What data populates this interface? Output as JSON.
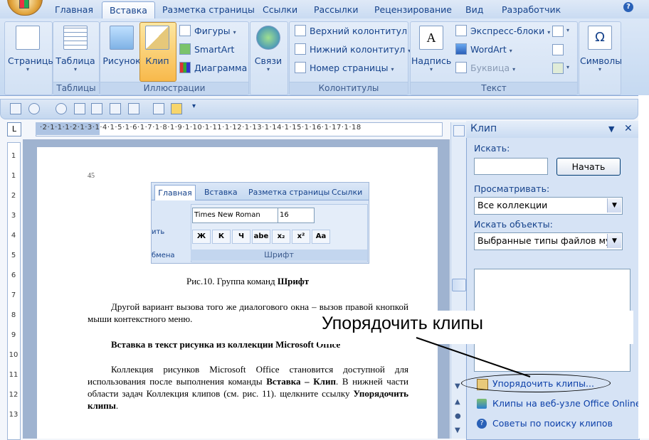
{
  "tabs": [
    "Главная",
    "Вставка",
    "Разметка страницы",
    "Ссылки",
    "Рассылки",
    "Рецензирование",
    "Вид",
    "Разработчик"
  ],
  "active_tab": "Вставка",
  "groups": {
    "pages": {
      "button": "Страницы"
    },
    "tables": {
      "button": "Таблица",
      "label": "Таблицы"
    },
    "illustrations": {
      "label": "Иллюстрации",
      "picture": "Рисунок",
      "clip": "Клип",
      "shapes": "Фигуры",
      "smartart": "SmartArt",
      "chart": "Диаграмма"
    },
    "links": {
      "button": "Связи"
    },
    "header_footer": {
      "label": "Колонтитулы",
      "header": "Верхний колонтитул",
      "footer": "Нижний колонтитул",
      "page_number": "Номер страницы"
    },
    "text": {
      "label": "Текст",
      "textbox": "Надпись",
      "quickparts": "Экспресс-блоки",
      "wordart": "WordArt",
      "dropcap": "Буквица"
    },
    "symbols": {
      "button": "Символы"
    }
  },
  "ruler": {
    "corner": "L",
    "h_marks": "·2·1·1·1·2·1·3·1·4·1·5·1·6·1·7·1·8·1·9·1·10·1·11·1·12·1·13·1·14·1·15·1·16·1·17·1·18",
    "v_marks": [
      "1",
      "1",
      "2",
      "3",
      "4",
      "5",
      "6",
      "7",
      "8",
      "9",
      "10",
      "11",
      "12",
      "13"
    ]
  },
  "document": {
    "page_number": "45",
    "embedded": {
      "tabs": [
        "Главная",
        "Вставка",
        "Разметка страницы",
        "Ссылки"
      ],
      "font": "Times New Roman",
      "size": "16",
      "group_label": "Шрифт",
      "left_label": "бмена",
      "left_text": "ить",
      "buttons": [
        "Ж",
        "К",
        "Ч",
        "abe",
        "x₂",
        "x²",
        "Aa"
      ]
    },
    "caption_prefix": "Рис.10. Группа команд ",
    "caption_bold": "Шрифт",
    "para1": "Другой  вариант вызова того же диалогового окна – вызов правой кнопкой мыши контекстного меню.",
    "heading": "Вставка в текст рисунка из коллекции Microsoft Office",
    "para2_a": "Коллекция рисунков Microsoft Office становится доступной для использования после выполнения команды ",
    "para2_b": "Вставка – Клип",
    "para2_c": ". В нижней части области задач Коллекция клипов (см. рис. 11). щелкните ссылку ",
    "para2_d": "Упорядочить клипы",
    "para2_e": "."
  },
  "task_pane": {
    "title": "Клип",
    "search_label": "Искать:",
    "search_value": "",
    "start_button": "Начать",
    "browse_label": "Просматривать:",
    "browse_value": "Все коллекции",
    "objects_label": "Искать объекты:",
    "objects_value": "Выбранные типы файлов муль",
    "links": [
      "Упорядочить клипы...",
      "Клипы на веб-узле Office Online",
      "Советы по поиску клипов"
    ]
  },
  "callout": "Упорядочить клипы",
  "colors": {
    "ribbon": "#c9dbf2",
    "text": "#15428b",
    "link": "#0b3fa8",
    "selected": "#f8b94b"
  }
}
